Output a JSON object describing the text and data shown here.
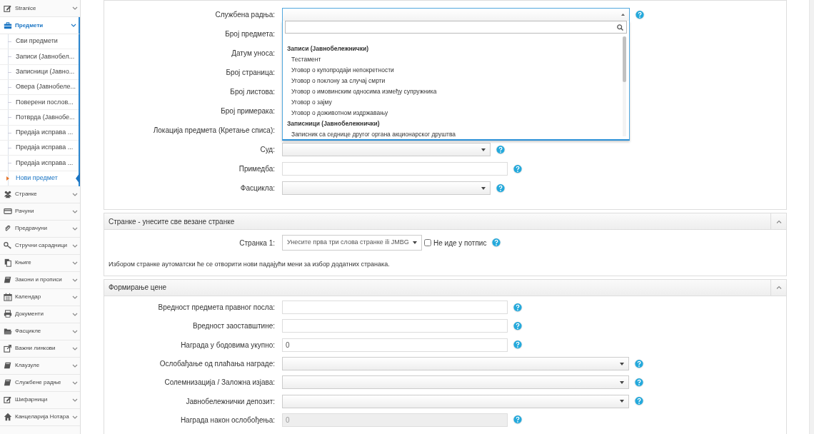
{
  "sidebar": {
    "items": [
      {
        "label": "Stranice",
        "selected": false
      },
      {
        "label": "Предмети",
        "selected": true,
        "children": [
          {
            "label": "Сви предмети",
            "selected": false
          },
          {
            "label": "Записи (Јавнобел...",
            "selected": false
          },
          {
            "label": "Записници (Јавно...",
            "selected": false
          },
          {
            "label": "Овера (Јавнобеле...",
            "selected": false
          },
          {
            "label": "Поверени послов...",
            "selected": false
          },
          {
            "label": "Потврда (Јавнобе...",
            "selected": false
          },
          {
            "label": "Предаја исправа ...",
            "selected": false
          },
          {
            "label": "Предаја исправа ...",
            "selected": false
          },
          {
            "label": "Предаја исправа ...",
            "selected": false
          },
          {
            "label": "Нови предмет",
            "selected": true
          }
        ]
      },
      {
        "label": "Странке",
        "selected": false
      },
      {
        "label": "Рачуни",
        "selected": false
      },
      {
        "label": "Предрачуни",
        "selected": false
      },
      {
        "label": "Стручни сарадници",
        "selected": false
      },
      {
        "label": "Књиге",
        "selected": false
      },
      {
        "label": "Закони и прописи",
        "selected": false
      },
      {
        "label": "Календар",
        "selected": false
      },
      {
        "label": "Документи",
        "selected": false
      },
      {
        "label": "Фасцикле",
        "selected": false
      },
      {
        "label": "Важни линкови",
        "selected": false
      },
      {
        "label": "Клаузуле",
        "selected": false
      },
      {
        "label": "Службене радње",
        "selected": false
      },
      {
        "label": "Шифарници",
        "selected": false
      },
      {
        "label": "Канцеларија Нотара",
        "selected": false
      }
    ]
  },
  "case_form": {
    "rows": [
      {
        "label": "Службена радња:",
        "kind": "dropdown"
      },
      {
        "label": "Број предмета:"
      },
      {
        "label": "Датум уноса:"
      },
      {
        "label": "Број страница:"
      },
      {
        "label": "Број листова:"
      },
      {
        "label": "Број примерака:"
      },
      {
        "label": "Локација предмета (Кретање списа):"
      },
      {
        "label": "Суд:",
        "kind": "select"
      },
      {
        "label": "Примедба:",
        "kind": "text"
      },
      {
        "label": "Фасцикла:",
        "kind": "select"
      }
    ],
    "dropdown": {
      "groups": [
        {
          "label": "Записи (Јавнобележнички)",
          "options": [
            "Тестамент",
            "Уговор о купопродаји непокретности",
            "Уговор о поклону за случај смрти",
            "Уговор о имовинским односима између супружника",
            "Уговор о зајму",
            "Уговор о доживотном издржавању"
          ]
        },
        {
          "label": "Записници (Јавнобележнички)",
          "options": [
            "Записник са седнице другог органа акционарског друштва"
          ]
        }
      ]
    }
  },
  "parties_section": {
    "title": "Странке - унесите све везане странке",
    "expanded": true,
    "party": {
      "label": "Странка 1:",
      "placeholder": "Унесите прва три слова странке ili JMBG",
      "checkbox": {
        "label": "Не иде у потпис",
        "checked": false
      }
    },
    "note": "Избором странке аутоматски ће се отворити нови падајући мени за избор додатних странака."
  },
  "pricing_section": {
    "title": "Формирање цене",
    "expanded": true,
    "rows": [
      {
        "label": "Вредност предмета правног посла:",
        "kind": "text"
      },
      {
        "label": "Вредност заоставштине:",
        "kind": "text"
      },
      {
        "label": "Награда у бодовима укупно:",
        "kind": "text",
        "value": "0"
      },
      {
        "label": "Ослобађање од плаћања награде:",
        "kind": "select"
      },
      {
        "label": "Солемнизација / Заложна изјава:",
        "kind": "select"
      },
      {
        "label": "Јавнобележнички депозит:",
        "kind": "select"
      },
      {
        "label": "Награда након ослобођења:",
        "kind": "text",
        "value": "0",
        "disabled": true
      }
    ]
  }
}
